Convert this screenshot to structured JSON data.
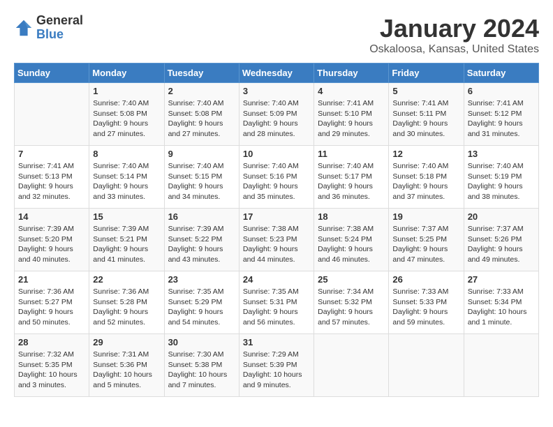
{
  "header": {
    "logo_general": "General",
    "logo_blue": "Blue",
    "month": "January 2024",
    "location": "Oskaloosa, Kansas, United States"
  },
  "days_of_week": [
    "Sunday",
    "Monday",
    "Tuesday",
    "Wednesday",
    "Thursday",
    "Friday",
    "Saturday"
  ],
  "weeks": [
    [
      {
        "day": "",
        "content": ""
      },
      {
        "day": "1",
        "content": "Sunrise: 7:40 AM\nSunset: 5:08 PM\nDaylight: 9 hours\nand 27 minutes."
      },
      {
        "day": "2",
        "content": "Sunrise: 7:40 AM\nSunset: 5:08 PM\nDaylight: 9 hours\nand 27 minutes."
      },
      {
        "day": "3",
        "content": "Sunrise: 7:40 AM\nSunset: 5:09 PM\nDaylight: 9 hours\nand 28 minutes."
      },
      {
        "day": "4",
        "content": "Sunrise: 7:41 AM\nSunset: 5:10 PM\nDaylight: 9 hours\nand 29 minutes."
      },
      {
        "day": "5",
        "content": "Sunrise: 7:41 AM\nSunset: 5:11 PM\nDaylight: 9 hours\nand 30 minutes."
      },
      {
        "day": "6",
        "content": "Sunrise: 7:41 AM\nSunset: 5:12 PM\nDaylight: 9 hours\nand 31 minutes."
      }
    ],
    [
      {
        "day": "7",
        "content": "Sunrise: 7:41 AM\nSunset: 5:13 PM\nDaylight: 9 hours\nand 32 minutes."
      },
      {
        "day": "8",
        "content": "Sunrise: 7:40 AM\nSunset: 5:14 PM\nDaylight: 9 hours\nand 33 minutes."
      },
      {
        "day": "9",
        "content": "Sunrise: 7:40 AM\nSunset: 5:15 PM\nDaylight: 9 hours\nand 34 minutes."
      },
      {
        "day": "10",
        "content": "Sunrise: 7:40 AM\nSunset: 5:16 PM\nDaylight: 9 hours\nand 35 minutes."
      },
      {
        "day": "11",
        "content": "Sunrise: 7:40 AM\nSunset: 5:17 PM\nDaylight: 9 hours\nand 36 minutes."
      },
      {
        "day": "12",
        "content": "Sunrise: 7:40 AM\nSunset: 5:18 PM\nDaylight: 9 hours\nand 37 minutes."
      },
      {
        "day": "13",
        "content": "Sunrise: 7:40 AM\nSunset: 5:19 PM\nDaylight: 9 hours\nand 38 minutes."
      }
    ],
    [
      {
        "day": "14",
        "content": "Sunrise: 7:39 AM\nSunset: 5:20 PM\nDaylight: 9 hours\nand 40 minutes."
      },
      {
        "day": "15",
        "content": "Sunrise: 7:39 AM\nSunset: 5:21 PM\nDaylight: 9 hours\nand 41 minutes."
      },
      {
        "day": "16",
        "content": "Sunrise: 7:39 AM\nSunset: 5:22 PM\nDaylight: 9 hours\nand 43 minutes."
      },
      {
        "day": "17",
        "content": "Sunrise: 7:38 AM\nSunset: 5:23 PM\nDaylight: 9 hours\nand 44 minutes."
      },
      {
        "day": "18",
        "content": "Sunrise: 7:38 AM\nSunset: 5:24 PM\nDaylight: 9 hours\nand 46 minutes."
      },
      {
        "day": "19",
        "content": "Sunrise: 7:37 AM\nSunset: 5:25 PM\nDaylight: 9 hours\nand 47 minutes."
      },
      {
        "day": "20",
        "content": "Sunrise: 7:37 AM\nSunset: 5:26 PM\nDaylight: 9 hours\nand 49 minutes."
      }
    ],
    [
      {
        "day": "21",
        "content": "Sunrise: 7:36 AM\nSunset: 5:27 PM\nDaylight: 9 hours\nand 50 minutes."
      },
      {
        "day": "22",
        "content": "Sunrise: 7:36 AM\nSunset: 5:28 PM\nDaylight: 9 hours\nand 52 minutes."
      },
      {
        "day": "23",
        "content": "Sunrise: 7:35 AM\nSunset: 5:29 PM\nDaylight: 9 hours\nand 54 minutes."
      },
      {
        "day": "24",
        "content": "Sunrise: 7:35 AM\nSunset: 5:31 PM\nDaylight: 9 hours\nand 56 minutes."
      },
      {
        "day": "25",
        "content": "Sunrise: 7:34 AM\nSunset: 5:32 PM\nDaylight: 9 hours\nand 57 minutes."
      },
      {
        "day": "26",
        "content": "Sunrise: 7:33 AM\nSunset: 5:33 PM\nDaylight: 9 hours\nand 59 minutes."
      },
      {
        "day": "27",
        "content": "Sunrise: 7:33 AM\nSunset: 5:34 PM\nDaylight: 10 hours\nand 1 minute."
      }
    ],
    [
      {
        "day": "28",
        "content": "Sunrise: 7:32 AM\nSunset: 5:35 PM\nDaylight: 10 hours\nand 3 minutes."
      },
      {
        "day": "29",
        "content": "Sunrise: 7:31 AM\nSunset: 5:36 PM\nDaylight: 10 hours\nand 5 minutes."
      },
      {
        "day": "30",
        "content": "Sunrise: 7:30 AM\nSunset: 5:38 PM\nDaylight: 10 hours\nand 7 minutes."
      },
      {
        "day": "31",
        "content": "Sunrise: 7:29 AM\nSunset: 5:39 PM\nDaylight: 10 hours\nand 9 minutes."
      },
      {
        "day": "",
        "content": ""
      },
      {
        "day": "",
        "content": ""
      },
      {
        "day": "",
        "content": ""
      }
    ]
  ]
}
